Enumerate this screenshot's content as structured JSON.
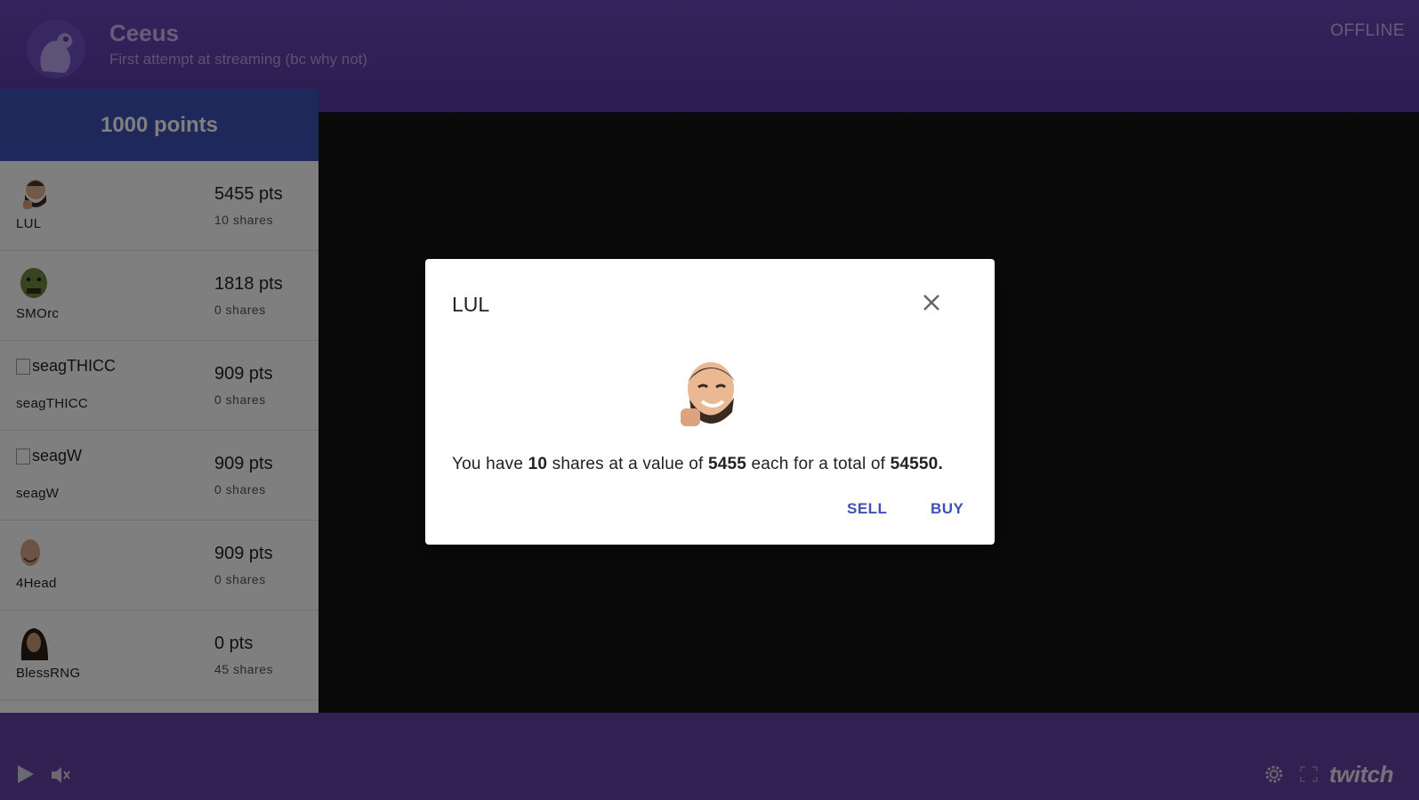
{
  "channel": {
    "name": "Ceeus",
    "subtitle": "First attempt at streaming (bc why not)",
    "status": "OFFLINE"
  },
  "sidebar": {
    "points_label": "1000 points",
    "items": [
      {
        "name": "LUL",
        "pts": "5455 pts",
        "shares": "10 shares",
        "alt": ""
      },
      {
        "name": "SMOrc",
        "pts": "1818 pts",
        "shares": "0 shares",
        "alt": ""
      },
      {
        "name": "seagTHICC",
        "pts": "909 pts",
        "shares": "0 shares",
        "alt": "seagTHICC"
      },
      {
        "name": "seagW",
        "pts": "909 pts",
        "shares": "0 shares",
        "alt": "seagW"
      },
      {
        "name": "4Head",
        "pts": "909 pts",
        "shares": "0 shares",
        "alt": ""
      },
      {
        "name": "BlessRNG",
        "pts": "0 pts",
        "shares": "45 shares",
        "alt": ""
      }
    ]
  },
  "dialog": {
    "title": "LUL",
    "text_prefix": "You have ",
    "shares": "10",
    "text_mid1": " shares at a value of ",
    "value": "5455",
    "text_mid2": " each for a total of ",
    "total": "54550.",
    "sell_label": "SELL",
    "buy_label": "BUY"
  },
  "footer": {
    "logo": "twitch"
  },
  "colors": {
    "header": "#6a46b8",
    "points_bar": "#3f51b5",
    "footer": "#6441a5",
    "button_text": "#3f51b5"
  }
}
